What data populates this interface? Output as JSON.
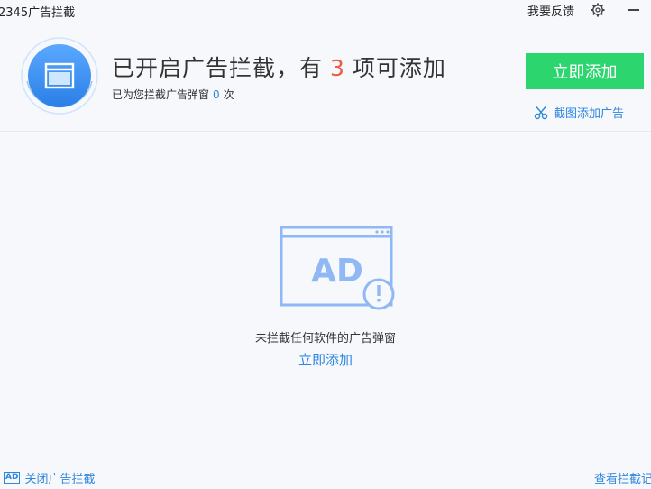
{
  "titlebar": {
    "app_title": "2345广告拦截",
    "feedback": "我要反馈"
  },
  "header": {
    "headline_prefix": "已开启广告拦截，有",
    "headline_count": "3",
    "headline_suffix": "项可添加",
    "subline_prefix": "已为您拦截广告弹窗",
    "subline_count": "0",
    "subline_suffix": "次",
    "add_now_button": "立即添加",
    "screenshot_add_link": "截图添加广告"
  },
  "main": {
    "illustration_text": "AD",
    "empty_message": "未拦截任何软件的广告弹窗",
    "add_now_link": "立即添加"
  },
  "footer": {
    "badge": "AD",
    "close_blocking": "关闭广告拦截",
    "view_blocked": "查看拦截记"
  },
  "colors": {
    "accent_blue": "#2e86de",
    "add_button_green": "#2dd56f",
    "count_red": "#f05a45",
    "illustration_blue": "#8fb8f5"
  }
}
